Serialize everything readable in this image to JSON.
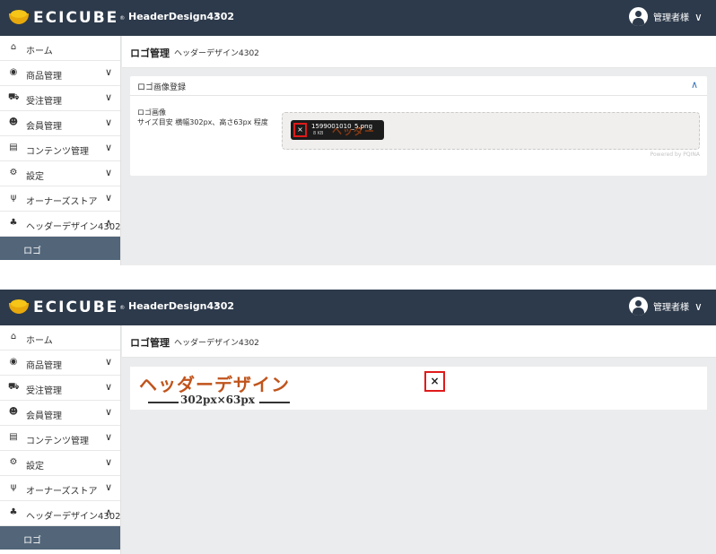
{
  "header": {
    "brand": "ECICUBE",
    "shop_name": "HeaderDesign4302",
    "shop_chevron": "›",
    "user_name": "管理者様",
    "user_chevron": "∨"
  },
  "sidebar": {
    "items": [
      {
        "label": "ホーム",
        "icon": "home-icon",
        "glyph": "⌂",
        "chevron": ""
      },
      {
        "label": "商品管理",
        "icon": "cube-icon",
        "glyph": "◉",
        "chevron": "∨"
      },
      {
        "label": "受注管理",
        "icon": "cart-icon",
        "glyph": "⛟",
        "chevron": "∨"
      },
      {
        "label": "会員管理",
        "icon": "users-icon",
        "glyph": "☻",
        "chevron": "∨"
      },
      {
        "label": "コンテンツ管理",
        "icon": "file-icon",
        "glyph": "▤",
        "chevron": "∨"
      },
      {
        "label": "設定",
        "icon": "gear-icon",
        "glyph": "⚙",
        "chevron": "∨"
      },
      {
        "label": "オーナーズストア",
        "icon": "plug-icon",
        "glyph": "ψ",
        "chevron": "∨"
      },
      {
        "label": "ヘッダーデザイン4302",
        "icon": "plugin-icon",
        "glyph": "♣",
        "chevron": "∧"
      }
    ],
    "sub_item": "ロゴ"
  },
  "breadcrumb": {
    "title": "ロゴ管理",
    "subtitle": "ヘッダーデザイン4302"
  },
  "card": {
    "header": "ロゴ画像登録",
    "collapse_chevron": "∧",
    "field_label_line1": "ロゴ画像",
    "field_label_line2": "サイズ目安 横幅302px、高さ63px 程度",
    "file_name": "1599001010_5.png",
    "file_size": "8 KB",
    "file_preview_text": "ヘッダーデザイン",
    "remove_glyph": "×",
    "powered_by": "Powered by PQINA"
  },
  "preview": {
    "logo_title": "ヘッダーデザイン",
    "logo_size": "302px×63px",
    "remove_glyph": "×"
  }
}
